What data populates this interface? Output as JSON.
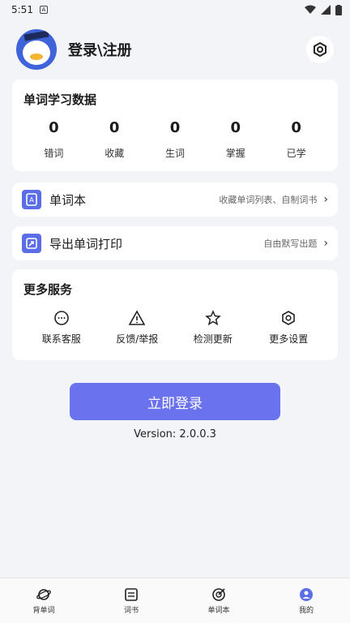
{
  "status": {
    "time": "5:51"
  },
  "header": {
    "title": "登录\\注册"
  },
  "stats": {
    "title": "单词学习数据",
    "items": [
      {
        "value": "0",
        "label": "错词"
      },
      {
        "value": "0",
        "label": "收藏"
      },
      {
        "value": "0",
        "label": "生词"
      },
      {
        "value": "0",
        "label": "掌握"
      },
      {
        "value": "0",
        "label": "已学"
      }
    ]
  },
  "wordbook": {
    "label": "单词本",
    "hint": "收藏单词列表、自制词书"
  },
  "export": {
    "label": "导出单词打印",
    "hint": "自由默写出题"
  },
  "services": {
    "title": "更多服务",
    "items": [
      {
        "label": "联系客服",
        "icon": "chat-icon"
      },
      {
        "label": "反馈/举报",
        "icon": "warning-icon"
      },
      {
        "label": "检测更新",
        "icon": "star-icon"
      },
      {
        "label": "更多设置",
        "icon": "gear-icon"
      }
    ]
  },
  "login": {
    "label": "立即登录"
  },
  "version": "Version: 2.0.0.3",
  "nav": [
    {
      "label": "背单词"
    },
    {
      "label": "词书"
    },
    {
      "label": "单词本"
    },
    {
      "label": "我的"
    }
  ],
  "colors": {
    "accent": "#6b72ee",
    "background": "#f3f4f7"
  }
}
